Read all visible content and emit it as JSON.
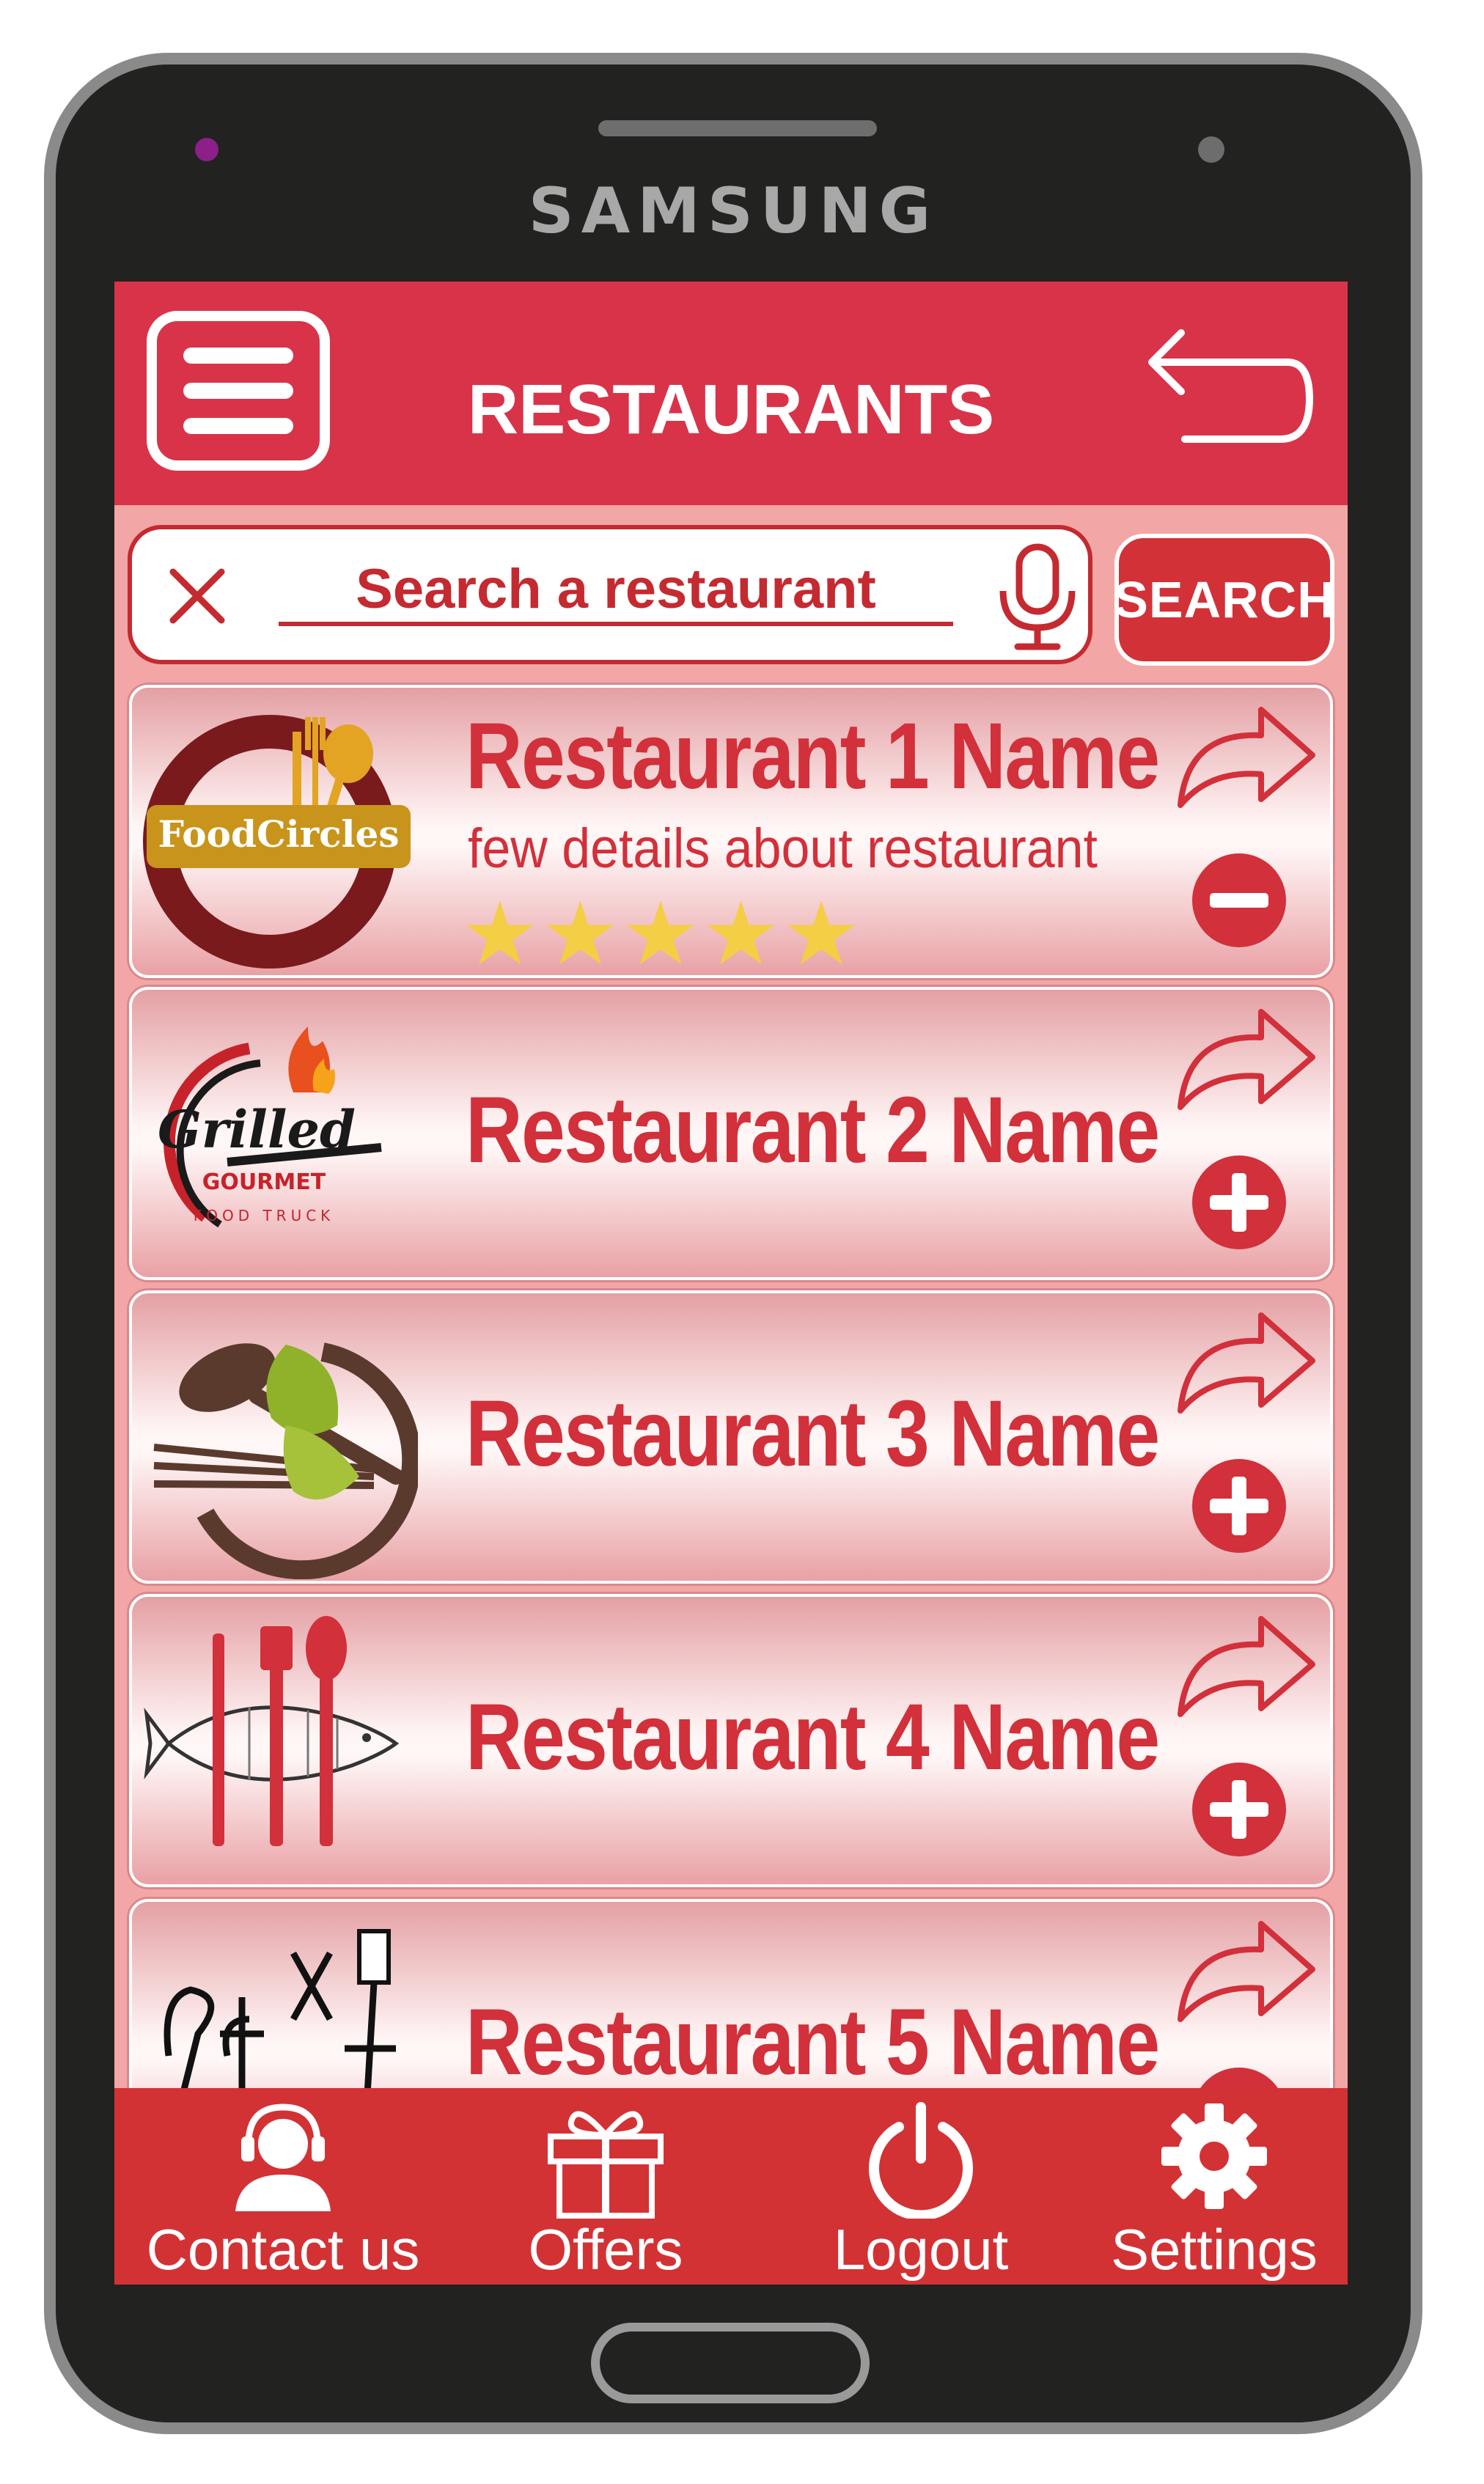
{
  "device": {
    "brand": "SAMSUNG"
  },
  "header": {
    "title": "RESTAURANTS"
  },
  "search": {
    "placeholder": "Search a restaurant",
    "value": "",
    "button_label": "SEARCH"
  },
  "restaurants": [
    {
      "name": "Restaurant 1 Name",
      "details": "few details about restaurant",
      "rating": 5,
      "logo_text": "FoodCircles",
      "action": "remove"
    },
    {
      "name": "Restaurant 2 Name",
      "logo_text": "Grilled",
      "logo_sub1": "GOURMET",
      "logo_sub2": "FOOD TRUCK",
      "action": "add"
    },
    {
      "name": "Restaurant 3 Name",
      "action": "add"
    },
    {
      "name": "Restaurant 4 Name",
      "action": "add"
    },
    {
      "name": "Restaurant 5 Name",
      "action": "remove"
    }
  ],
  "bottom_nav": [
    {
      "label": "Contact us",
      "icon": "headset-user-icon"
    },
    {
      "label": "Offers",
      "icon": "gift-icon"
    },
    {
      "label": "Logout",
      "icon": "power-icon"
    },
    {
      "label": "Settings",
      "icon": "gear-icon"
    }
  ],
  "colors": {
    "accent": "#d9334a",
    "text_red": "#d2303a",
    "star": "#f4ce44",
    "list_bg": "#f3a6a6"
  }
}
